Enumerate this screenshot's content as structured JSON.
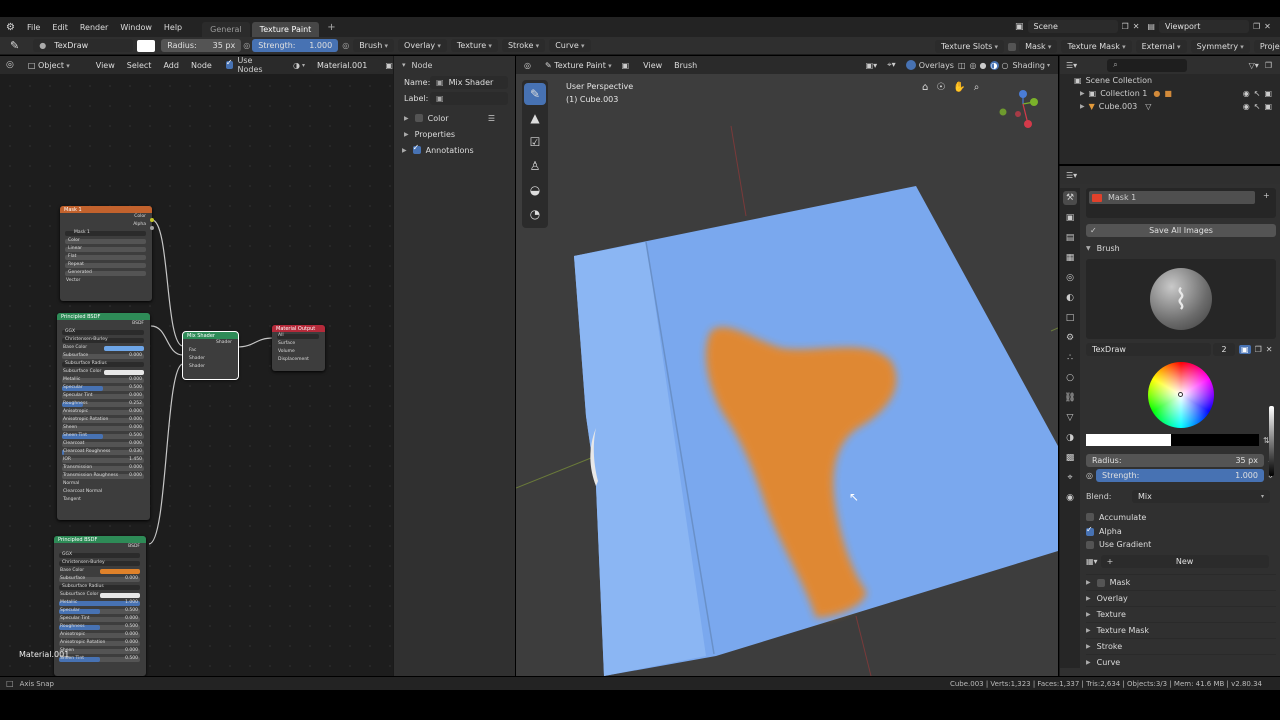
{
  "topbar": {
    "menus": [
      "File",
      "Edit",
      "Render",
      "Window",
      "Help"
    ],
    "workspaces": [
      {
        "label": "General",
        "active": false
      },
      {
        "label": "Texture Paint",
        "active": true
      }
    ],
    "add_tab": "+",
    "scene_label": "Scene",
    "view_layer_label": "Viewport"
  },
  "tool_header": {
    "brush_name": "TexDraw",
    "radius_label": "Radius:",
    "radius_value": "35 px",
    "strength_label": "Strength:",
    "strength_value": "1.000",
    "dropdowns": [
      "Brush",
      "Overlay",
      "Texture",
      "Stroke",
      "Curve"
    ],
    "right_items": [
      "Texture Slots",
      "Mask",
      "Texture Mask",
      "External",
      "Symmetry",
      "Project Paint"
    ]
  },
  "node_editor": {
    "header": {
      "mode": "Object",
      "menus": [
        "View",
        "Select",
        "Add",
        "Node"
      ],
      "use_nodes": "Use Nodes",
      "material": "Material.001"
    },
    "material_label": "Material.001",
    "mask_node": {
      "title": "Mask 1",
      "outputs": [
        "Color",
        "Alpha"
      ],
      "image": "Mask 1",
      "rows": [
        "Color",
        "Linear",
        "Flat",
        "Repeat",
        "Generated"
      ],
      "vector": "Vector"
    },
    "bsdf1": {
      "title": "Principled BSDF",
      "out": "BSDF",
      "rows": [
        {
          "t": "GGX",
          "dd": true
        },
        {
          "t": "Christensen-Burley",
          "dd": true
        },
        {
          "t": "Base Color",
          "color": "#6ea6e8"
        },
        {
          "t": "Subsurface",
          "v": "0.000",
          "f": 0
        },
        {
          "t": "Subsurface Radius",
          "dd": true
        },
        {
          "t": "Subsurface Color",
          "color": "#e8e8e8"
        },
        {
          "t": "Metallic",
          "v": "0.000",
          "f": 0
        },
        {
          "t": "Specular",
          "v": "0.500",
          "f": 0.5
        },
        {
          "t": "Specular Tint",
          "v": "0.000",
          "f": 0
        },
        {
          "t": "Roughness",
          "v": "0.252",
          "f": 0.25
        },
        {
          "t": "Anisotropic",
          "v": "0.000",
          "f": 0
        },
        {
          "t": "Anisotropic Rotation",
          "v": "0.000",
          "f": 0
        },
        {
          "t": "Sheen",
          "v": "0.000",
          "f": 0
        },
        {
          "t": "Sheen Tint",
          "v": "0.500",
          "f": 0.5
        },
        {
          "t": "Clearcoat",
          "v": "0.000",
          "f": 0
        },
        {
          "t": "Clearcoat Roughness",
          "v": "0.030",
          "f": 0.03
        },
        {
          "t": "IOR",
          "v": "1.450",
          "f": 0
        },
        {
          "t": "Transmission",
          "v": "0.000",
          "f": 0
        },
        {
          "t": "Transmission Roughness",
          "v": "0.000",
          "f": 0
        },
        {
          "t": "Normal"
        },
        {
          "t": "Clearcoat Normal"
        },
        {
          "t": "Tangent"
        }
      ]
    },
    "bsdf2": {
      "title": "Principled BSDF",
      "out": "BSDF",
      "rows": [
        {
          "t": "GGX",
          "dd": true
        },
        {
          "t": "Christensen-Burley",
          "dd": true
        },
        {
          "t": "Base Color",
          "color": "#e0822a"
        },
        {
          "t": "Subsurface",
          "v": "0.000",
          "f": 0
        },
        {
          "t": "Subsurface Radius",
          "dd": true
        },
        {
          "t": "Subsurface Color",
          "color": "#e8e8e8"
        },
        {
          "t": "Metallic",
          "v": "1.000",
          "f": 1
        },
        {
          "t": "Specular",
          "v": "0.500",
          "f": 0.5
        },
        {
          "t": "Specular Tint",
          "v": "0.000",
          "f": 0
        },
        {
          "t": "Roughness",
          "v": "0.500",
          "f": 0.5
        },
        {
          "t": "Anisotropic",
          "v": "0.000",
          "f": 0
        },
        {
          "t": "Anisotropic Rotation",
          "v": "0.000",
          "f": 0
        },
        {
          "t": "Sheen",
          "v": "0.000",
          "f": 0
        },
        {
          "t": "Sheen Tint",
          "v": "0.500",
          "f": 0.5
        }
      ]
    },
    "mix_node": {
      "title": "Mix Shader",
      "out": "Shader",
      "inputs": [
        "Fac",
        "Shader",
        "Shader"
      ]
    },
    "output_node": {
      "title": "Material Output",
      "target": "All",
      "inputs": [
        "Surface",
        "Volume",
        "Displacement"
      ]
    }
  },
  "n_panel": {
    "node_header": "Node",
    "name_label": "Name:",
    "name_value": "Mix Shader",
    "label_label": "Label:",
    "color_label": "Color",
    "properties_label": "Properties",
    "annotations_label": "Annotations"
  },
  "viewport": {
    "mode": "Texture Paint",
    "menus": [
      "View",
      "Brush"
    ],
    "overlays": "Overlays",
    "shading": "Shading",
    "view_name": "User Perspective",
    "object_name": "(1) Cube.003"
  },
  "outliner": {
    "scene_collection": "Scene Collection",
    "collection": "Collection 1",
    "object": "Cube.003"
  },
  "properties": {
    "mask_slot": "Mask 1",
    "save_all": "Save All Images",
    "brush_header": "Brush",
    "brush_name": "TexDraw",
    "brush_users": "2",
    "radius_label": "Radius:",
    "radius_value": "35 px",
    "strength_label": "Strength:",
    "strength_value": "1.000",
    "blend_label": "Blend:",
    "blend_value": "Mix",
    "accumulate": "Accumulate",
    "alpha": "Alpha",
    "use_gradient": "Use Gradient",
    "new_label": "New",
    "subpanels": [
      "Mask",
      "Overlay",
      "Texture",
      "Texture Mask",
      "Stroke",
      "Curve"
    ]
  },
  "statusbar": {
    "left": "Axis Snap",
    "right": "Cube.003 | Verts:1,323 | Faces:1,337 | Tris:2,634 | Objects:3/3 | Mem: 41.6 MB | v2.80.34"
  },
  "colors": {
    "accent": "#4772b3",
    "bg_dark": "#1d1d1d",
    "panel": "#303030",
    "plane_blue": "#7aa8ee",
    "paint_orange": "#e5872c"
  }
}
